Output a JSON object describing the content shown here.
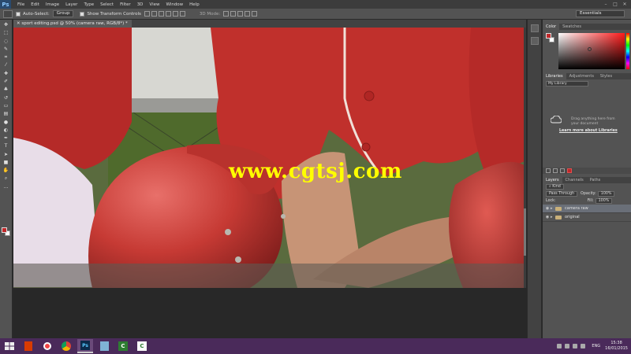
{
  "menubar": {
    "logo": "Ps",
    "items": [
      "File",
      "Edit",
      "Image",
      "Layer",
      "Type",
      "Select",
      "Filter",
      "3D",
      "View",
      "Window",
      "Help"
    ],
    "controls": [
      "–",
      "□",
      "✕"
    ]
  },
  "options": {
    "auto_select_label": "Auto-Select:",
    "auto_select_value": "Group",
    "transform_label": "Show Transform Controls",
    "mode_3d_label": "3D Mode:",
    "workspace": "Essentials"
  },
  "document": {
    "tab_title": "sport editing.psd @ 50% (camera raw, RGB/8*) *",
    "watermark": "www.cgtsj.com"
  },
  "panels": {
    "color_tabs": [
      "Color",
      "Swatches"
    ],
    "library_tabs": [
      "Libraries",
      "Adjustments",
      "Styles"
    ],
    "library_dropdown": "My Library",
    "library_message": "Drag anything here from your document",
    "library_link": "Learn more about Libraries",
    "layers_tabs": [
      "Layers",
      "Channels",
      "Paths"
    ],
    "kind_label": "Kind",
    "blend_mode": "Pass Through",
    "opacity_label": "Opacity:",
    "opacity_value": "100%",
    "lock_label": "Lock:",
    "fill_label": "Fill:",
    "fill_value": "100%",
    "layers": [
      {
        "name": "camera raw",
        "selected": true
      },
      {
        "name": "original",
        "selected": false
      }
    ]
  },
  "taskbar": {
    "lang": "ENG",
    "time": "15:38",
    "date": "16/01/2015",
    "ps_label": "Ps"
  },
  "colors": {
    "accent_red": "#c0282a",
    "taskbar": "#4a2a5a",
    "watermark": "#ffff00"
  }
}
